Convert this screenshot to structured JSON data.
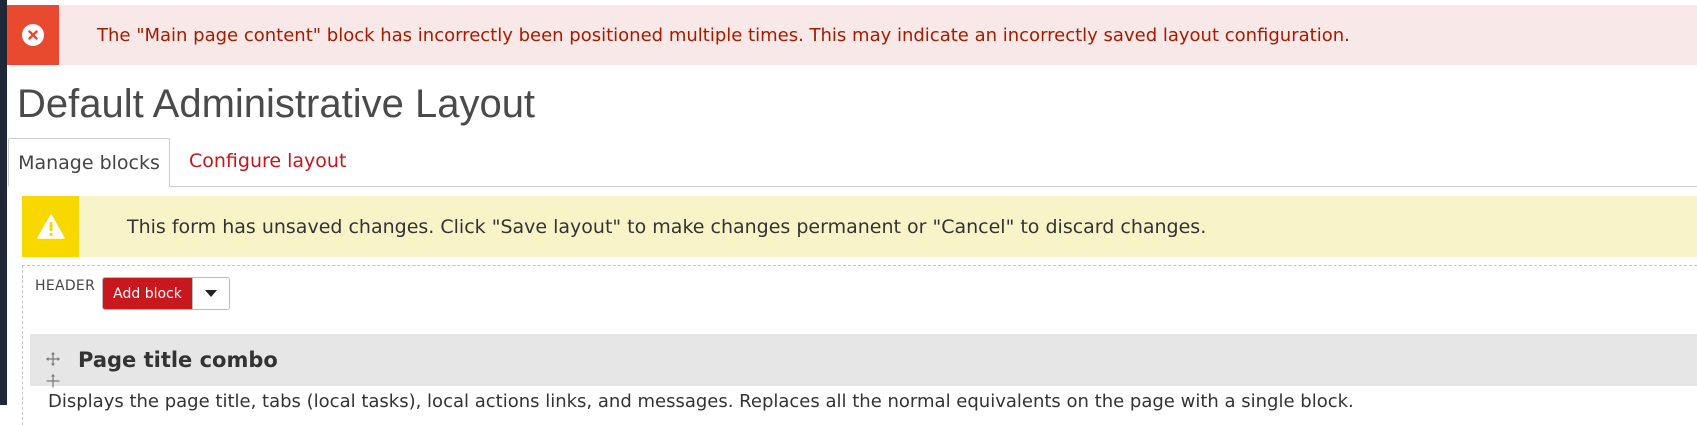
{
  "error_message": {
    "icon": "error-x-circle-icon",
    "text": "The \"Main page content\" block has incorrectly been positioned multiple times. This may indicate an incorrectly saved layout configuration."
  },
  "page": {
    "title": "Default Administrative Layout"
  },
  "tabs": [
    {
      "label": "Manage blocks",
      "active": true
    },
    {
      "label": "Configure layout",
      "active": false
    }
  ],
  "warning_message": {
    "icon": "warning-triangle-icon",
    "text": "This form has unsaved changes. Click \"Save layout\" to make changes permanent or \"Cancel\" to discard changes."
  },
  "region": {
    "label": "HEADER",
    "add_block_label": "Add block"
  },
  "block": {
    "title": "Page title combo",
    "description": "Displays the page title, tabs (local tasks), local actions links, and messages. Replaces all the normal equivalents on the page with a single block."
  },
  "colors": {
    "error_accent": "#e84a2f",
    "error_background": "#f8e8e8",
    "error_text": "#a51b00",
    "warning_accent": "#f9d800",
    "warning_background": "#f8f4c8",
    "link": "#c4161c",
    "primary_button": "#c9171e",
    "block_header": "#e6e6e6"
  }
}
